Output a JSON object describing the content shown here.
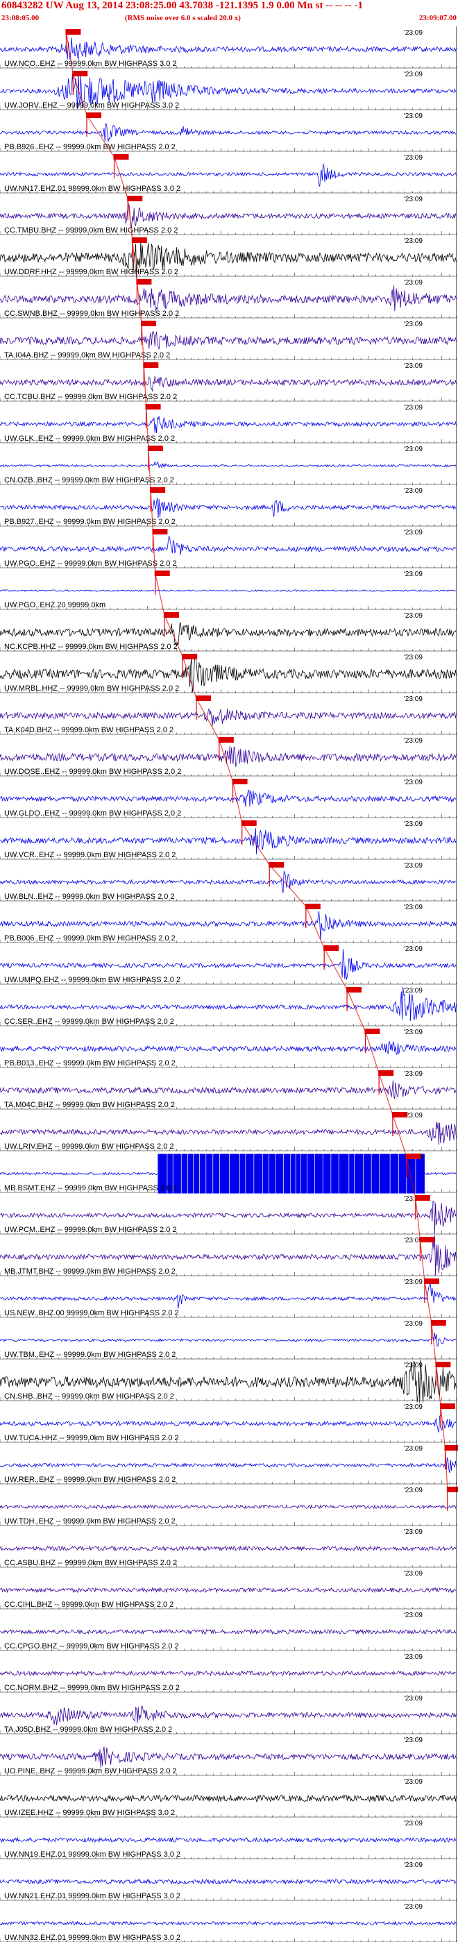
{
  "header": {
    "title": "60843282 UW Aug 13, 2014 23:08:25.00   43.7038 -121.1395  1.9 0.00 Mn st -- -- --  -1",
    "start_time": "23:08:05.00",
    "note": "(RMS noise over 6.0 s scaled 20.0 x)",
    "end_time": "23:09:07.00"
  },
  "colors": {
    "title": "#dd0000",
    "pick_box": "#dd0000",
    "pick_line": "#dd0000",
    "axis": "#000000",
    "trace_blue": "#0000ee",
    "trace_purple": "#330099",
    "trace_black": "#000000"
  },
  "chart_data": {
    "type": "line",
    "title": "60843282 UW Aug 13, 2014 23:08:25.00   43.7038 -121.1395  1.9 0.00 Mn st -- -- --  -1",
    "x_range": [
      "23:08:05.00",
      "23:09:07.00"
    ],
    "end_tick_label": "23:09",
    "traces": [
      {
        "label": "UW.NCO..EHZ -- 99999.0km BW  HIGHPASS  3.0  2",
        "color": "#0000ee",
        "amp": 0.12,
        "bursts": [
          [
            0.15,
            0.1,
            0.5
          ]
        ],
        "pick": 0.145
      },
      {
        "label": "UW.JORV..EHZ -- 99999.0km BW  HIGHPASS  3.0  2",
        "color": "#0000ee",
        "amp": 0.1,
        "bursts": [
          [
            0.16,
            0.15,
            1.0
          ],
          [
            0.32,
            0.05,
            0.5
          ]
        ],
        "pick": 0.16
      },
      {
        "label": "PB.B926..EHZ -- 99999.0km BW  HIGHPASS  2.0  2",
        "color": "#0000ee",
        "amp": 0.08,
        "bursts": [
          [
            0.23,
            0.03,
            0.6
          ],
          [
            0.4,
            0.02,
            0.4
          ]
        ],
        "pick": 0.19
      },
      {
        "label": "UW.NN17.EHZ.01 99999.0km BW  HIGHPASS  3.0  2",
        "color": "#0000ee",
        "amp": 0.08,
        "bursts": [
          [
            0.7,
            0.02,
            0.8
          ]
        ],
        "pick": 0.25
      },
      {
        "label": "CC.TMBU.BHZ -- 99999.0km BW  HIGHPASS  2.0  2",
        "color": "#330099",
        "amp": 0.12,
        "bursts": [
          [
            0.28,
            0.05,
            0.6
          ]
        ],
        "pick": 0.28
      },
      {
        "label": "UW.DDRF.HHZ -- 99999.0km BW  HIGHPASS  2.0  2",
        "color": "#000000",
        "amp": 0.22,
        "bursts": [
          [
            0.29,
            0.1,
            0.9
          ]
        ],
        "pick": 0.29
      },
      {
        "label": "CC.SWNB.BHZ -- 99999.0km BW  HIGHPASS  2.0  2",
        "color": "#330099",
        "amp": 0.18,
        "bursts": [
          [
            0.32,
            0.1,
            0.5
          ],
          [
            0.86,
            0.06,
            0.5
          ]
        ],
        "pick": 0.3
      },
      {
        "label": "TA.I04A.BHZ -- 99999.0km BW  HIGHPASS  2.0  2",
        "color": "#330099",
        "amp": 0.18,
        "bursts": [
          [
            0.33,
            0.05,
            0.4
          ]
        ],
        "pick": 0.31
      },
      {
        "label": "CC.TCBU.BHZ -- 99999.0km BW  HIGHPASS  2.0  2",
        "color": "#330099",
        "amp": 0.14,
        "bursts": [
          [
            0.33,
            0.04,
            0.3
          ]
        ],
        "pick": 0.315
      },
      {
        "label": "UW.GLK..EHZ -- 99999.0km BW  HIGHPASS  2.0  2",
        "color": "#0000ee",
        "amp": 0.1,
        "bursts": [
          [
            0.34,
            0.04,
            0.4
          ]
        ],
        "pick": 0.32
      },
      {
        "label": "CN.OZB..BHZ -- 99999.0km BW  HIGHPASS  2.0  2",
        "color": "#0000ee",
        "amp": 0.05,
        "bursts": [
          [
            0.34,
            0.02,
            0.2
          ]
        ],
        "pick": 0.325
      },
      {
        "label": "PB.B927..EHZ -- 99999.0km BW  HIGHPASS  2.0  2",
        "color": "#0000ee",
        "amp": 0.1,
        "bursts": [
          [
            0.34,
            0.03,
            0.6
          ],
          [
            0.6,
            0.02,
            0.5
          ]
        ],
        "pick": 0.33
      },
      {
        "label": "UW.PGO..EHZ -- 99999.0km BW  HIGHPASS  2.0  2",
        "color": "#0000ee",
        "amp": 0.12,
        "bursts": [
          [
            0.37,
            0.02,
            0.8
          ]
        ],
        "pick": 0.335
      },
      {
        "label": "UW.PGO..EHZ.20 99999.0km",
        "color": "#0000ee",
        "amp": 0.04,
        "bursts": [],
        "pick": 0.34
      },
      {
        "label": "NC.KCPB.HHZ -- 99999.0km BW  HIGHPASS  2.0  2",
        "color": "#000000",
        "amp": 0.18,
        "bursts": [
          [
            0.38,
            0.04,
            0.6
          ]
        ],
        "pick": 0.36
      },
      {
        "label": "UW.MRBL.HHZ -- 99999.0km BW  HIGHPASS  2.0  2",
        "color": "#000000",
        "amp": 0.22,
        "bursts": [
          [
            0.42,
            0.05,
            1.0
          ]
        ],
        "pick": 0.4
      },
      {
        "label": "TA.K04D.BHZ -- 99999.0km BW  HIGHPASS  2.0  2",
        "color": "#330099",
        "amp": 0.15,
        "bursts": [
          [
            0.46,
            0.05,
            0.5
          ]
        ],
        "pick": 0.43
      },
      {
        "label": "UW.DOSE..EHZ -- 99999.0km BW  HIGHPASS  2.0  2",
        "color": "#330099",
        "amp": 0.18,
        "bursts": [
          [
            0.5,
            0.05,
            0.5
          ]
        ],
        "pick": 0.48
      },
      {
        "label": "UW.GLDO..EHZ -- 99999.0km BW  HIGHPASS  2.0  2",
        "color": "#0000ee",
        "amp": 0.12,
        "bursts": [
          [
            0.54,
            0.05,
            0.4
          ]
        ],
        "pick": 0.51
      },
      {
        "label": "UW.VCR..EHZ -- 99999.0km BW  HIGHPASS  2.0  2",
        "color": "#0000ee",
        "amp": 0.15,
        "bursts": [
          [
            0.56,
            0.05,
            0.6
          ]
        ],
        "pick": 0.53
      },
      {
        "label": "UW.BLN..EHZ -- 99999.0km BW  HIGHPASS  2.0  2",
        "color": "#0000ee",
        "amp": 0.1,
        "bursts": [
          [
            0.62,
            0.02,
            0.6
          ]
        ],
        "pick": 0.59
      },
      {
        "label": "PB.B006..EHZ -- 99999.0km BW  HIGHPASS  2.0  2",
        "color": "#0000ee",
        "amp": 0.12,
        "bursts": [
          [
            0.7,
            0.03,
            0.8
          ]
        ],
        "pick": 0.67
      },
      {
        "label": "UW.UMPQ.EHZ -- 99999.0km BW  HIGHPASS  2.0  2",
        "color": "#0000ee",
        "amp": 0.1,
        "bursts": [
          [
            0.75,
            0.02,
            1.0
          ]
        ],
        "pick": 0.71
      },
      {
        "label": "CC.SER..EHZ -- 99999.0km BW  HIGHPASS  2.0  2",
        "color": "#0000ee",
        "amp": 0.1,
        "bursts": [
          [
            0.88,
            0.08,
            0.9
          ]
        ],
        "pick": 0.76
      },
      {
        "label": "PB.B013..EHZ -- 99999.0km BW  HIGHPASS  2.0  2",
        "color": "#0000ee",
        "amp": 0.12,
        "bursts": [
          [
            0.84,
            0.04,
            0.4
          ]
        ],
        "pick": 0.8
      },
      {
        "label": "TA.M04C.BHZ -- 99999.0km BW  HIGHPASS  2.0  2",
        "color": "#330099",
        "amp": 0.14,
        "bursts": [
          [
            0.86,
            0.04,
            0.4
          ]
        ],
        "pick": 0.83
      },
      {
        "label": "UW.LRIV.EHZ -- 99999.0km BW  HIGHPASS  2.0  2",
        "color": "#330099",
        "amp": 0.12,
        "bursts": [
          [
            0.95,
            0.05,
            0.8
          ]
        ],
        "pick": 0.86
      },
      {
        "label": "MB.BSMT.EHZ -- 99999.0km BW  HIGHPASS  2.0  2",
        "color": "#0000ee",
        "amp": 0.06,
        "bursts": [],
        "block": [
          0.345,
          0.93
        ],
        "pick": 0.89
      },
      {
        "label": "UW.PCM..EHZ -- 99999.0km BW  HIGHPASS  2.0  2",
        "color": "#330099",
        "amp": 0.1,
        "bursts": [
          [
            0.95,
            0.04,
            0.9
          ]
        ],
        "pick": 0.91
      },
      {
        "label": "MB.JTMT.BHZ -- 99999.0km BW  HIGHPASS  2.0  2",
        "color": "#330099",
        "amp": 0.12,
        "bursts": [
          [
            0.95,
            0.04,
            1.0
          ]
        ],
        "pick": 0.92
      },
      {
        "label": "US.NEW..BHZ.00 99999.0km BW  HIGHPASS  2.0  2",
        "color": "#0000ee",
        "amp": 0.08,
        "bursts": [
          [
            0.94,
            0.02,
            0.8
          ],
          [
            0.39,
            0.01,
            0.5
          ]
        ],
        "pick": 0.93
      },
      {
        "label": "UW.TBM..EHZ -- 99999.0km BW  HIGHPASS  2.0  2",
        "color": "#0000ee",
        "amp": 0.06,
        "bursts": [
          [
            0.95,
            0.02,
            0.4
          ]
        ],
        "pick": 0.945
      },
      {
        "label": "CN.SHB..BHZ -- 99999.0km BW  HIGHPASS  2.0  2",
        "color": "#000000",
        "amp": 0.25,
        "bursts": [
          [
            0.9,
            0.12,
            1.0
          ]
        ],
        "pick": 0.955
      },
      {
        "label": "UW.TUCA.HHZ -- 99999.0km BW  HIGHPASS  2.0  2",
        "color": "#0000ee",
        "amp": 0.1,
        "bursts": [
          [
            0.96,
            0.03,
            0.4
          ]
        ],
        "pick": 0.965
      },
      {
        "label": "UW.RER..EHZ -- 99999.0km BW  HIGHPASS  2.0  2",
        "color": "#0000ee",
        "amp": 0.08,
        "bursts": [
          [
            0.98,
            0.02,
            0.4
          ]
        ],
        "pick": 0.975
      },
      {
        "label": "UW.TDH..EHZ -- 99999.0km BW  HIGHPASS  2.0  2",
        "color": "#330099",
        "amp": 0.08,
        "bursts": [],
        "pick": 0.98
      },
      {
        "label": "CC.ASBU.BHZ -- 99999.0km BW  HIGHPASS  2.0  2",
        "color": "#330099",
        "amp": 0.1,
        "bursts": []
      },
      {
        "label": "CC.CIHL.BHZ -- 99999.0km BW  HIGHPASS  2.0  2",
        "color": "#330099",
        "amp": 0.1,
        "bursts": []
      },
      {
        "label": "CC.CPGO.BHZ -- 99999.0km BW  HIGHPASS  2.0  2",
        "color": "#330099",
        "amp": 0.1,
        "bursts": []
      },
      {
        "label": "CC.NORM.BHZ -- 99999.0km BW  HIGHPASS  2.0  2",
        "color": "#330099",
        "amp": 0.1,
        "bursts": []
      },
      {
        "label": "TA.J05D.BHZ -- 99999.0km BW  HIGHPASS  2.0  2",
        "color": "#330099",
        "amp": 0.12,
        "bursts": [
          [
            0.12,
            0.06,
            0.4
          ],
          [
            0.3,
            0.05,
            0.4
          ]
        ]
      },
      {
        "label": "UO.PINE..BHZ -- 99999.0km BW  HIGHPASS  2.0  2",
        "color": "#330099",
        "amp": 0.14,
        "bursts": [
          [
            0.22,
            0.06,
            0.4
          ]
        ]
      },
      {
        "label": "UW.IZEE.HHZ -- 99999.0km BW  HIGHPASS  3.0  2",
        "color": "#000000",
        "amp": 0.15,
        "bursts": []
      },
      {
        "label": "UW.NN19.EHZ.01 99999.0km BW  HIGHPASS  3.0  2",
        "color": "#0000ee",
        "amp": 0.1,
        "bursts": []
      },
      {
        "label": "UW.NN21.EHZ.01 99999.0km BW  HIGHPASS  3.0  2",
        "color": "#0000ee",
        "amp": 0.1,
        "bursts": []
      },
      {
        "label": "UW.NN32.EHZ.01 99999.0km BW  HIGHPASS  3.0  2",
        "color": "#0000ee",
        "amp": 0.08,
        "bursts": []
      }
    ]
  }
}
